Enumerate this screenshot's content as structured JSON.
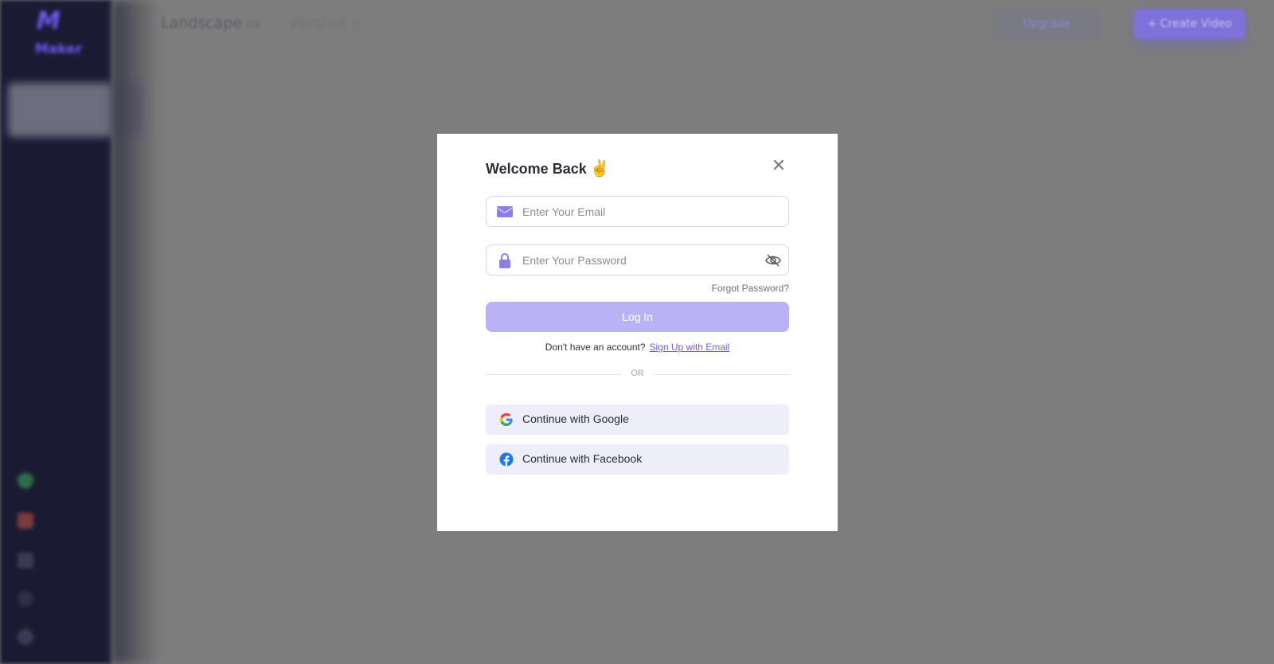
{
  "app": {
    "brand_name": "Maker",
    "tabs": [
      {
        "label": "Landscape",
        "icon": "monitor-icon"
      },
      {
        "label": "Portrait",
        "icon": "phone-icon"
      }
    ],
    "upgrade_label": "Upgrade",
    "create_label": "+ Create Video",
    "sidebar_icons": [
      "diamond-icon",
      "gift-icon",
      "translate-icon",
      "headset-icon",
      "user-icon"
    ]
  },
  "modal": {
    "title": "Welcome Back",
    "title_emoji": "✌",
    "email": {
      "placeholder": "Enter Your Email",
      "icon": "mail-icon",
      "value": ""
    },
    "password": {
      "placeholder": "Enter Your Password",
      "icon": "lock-icon",
      "toggle_icon": "eye-off-icon",
      "value": ""
    },
    "forgot_label": "Forgot Password?",
    "login_label": "Log In",
    "signup_prompt": "Don't have an account?",
    "signup_link": "Sign Up with Email",
    "divider_label": "OR",
    "google_label": "Continue with Google",
    "facebook_label": "Continue with Facebook"
  },
  "colors": {
    "accent": "#6f5ce8",
    "login_button": "#b9b2f5",
    "social_button": "#eeeefb",
    "sidebar": "#1b1a33",
    "overlay": "#7d7d7d"
  }
}
